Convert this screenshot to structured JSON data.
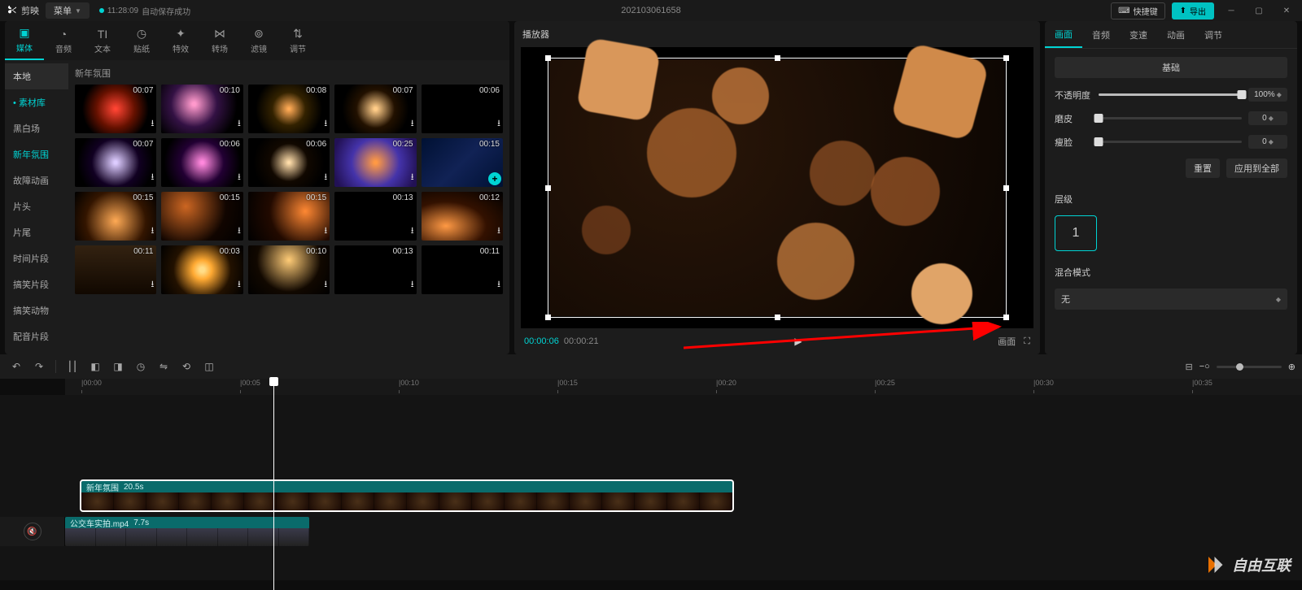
{
  "titleBar": {
    "appName": "剪映",
    "menu": "菜单",
    "autoSaveTime": "11:28:09",
    "autoSaveText": "自动保存成功",
    "projectName": "202103061658",
    "shortcut": "快捷键",
    "export": "导出"
  },
  "mediaTabs": [
    {
      "label": "媒体",
      "icon": "▣"
    },
    {
      "label": "音频",
      "icon": "◔"
    },
    {
      "label": "文本",
      "icon": "TI"
    },
    {
      "label": "贴纸",
      "icon": "◷"
    },
    {
      "label": "特效",
      "icon": "✦"
    },
    {
      "label": "转场",
      "icon": "⋈"
    },
    {
      "label": "滤镜",
      "icon": "⊚"
    },
    {
      "label": "调节",
      "icon": "⇅"
    }
  ],
  "mediaSide": {
    "items": [
      "本地",
      "• 素材库",
      "黑白场",
      "新年氛围",
      "故障动画",
      "片头",
      "片尾",
      "时间片段",
      "搞笑片段",
      "搞笑动物",
      "配音片段"
    ]
  },
  "mediaGrid": {
    "title": "新年氛围",
    "times": [
      "00:07",
      "00:10",
      "00:08",
      "00:07",
      "00:06",
      "00:07",
      "00:06",
      "00:06",
      "00:25",
      "00:15",
      "00:15",
      "00:15",
      "00:15",
      "00:13",
      "00:12",
      "00:11",
      "00:03",
      "00:10",
      "00:13",
      "00:11"
    ]
  },
  "player": {
    "title": "播放器",
    "current": "00:00:06",
    "total": "00:00:21",
    "ratio": "画面"
  },
  "propTabs": [
    "画面",
    "音频",
    "变速",
    "动画",
    "调节"
  ],
  "props": {
    "basic": "基础",
    "opacity": {
      "label": "不透明度",
      "value": "100%",
      "pct": 100
    },
    "skin": {
      "label": "磨皮",
      "value": "0",
      "pct": 0
    },
    "face": {
      "label": "瘦脸",
      "value": "0",
      "pct": 0
    },
    "reset": "重置",
    "applyAll": "应用到全部",
    "layerLabel": "层级",
    "layer": "1",
    "blendLabel": "混合模式",
    "blend": "无"
  },
  "timeline": {
    "ruler": [
      "00:00",
      "00:05",
      "00:10",
      "00:15",
      "00:20",
      "00:25",
      "00:30",
      "00:35"
    ],
    "clip1": {
      "name": "新年氛围",
      "dur": "20.5s"
    },
    "clip2": {
      "name": "公交车实拍.mp4",
      "dur": "7.7s"
    }
  },
  "watermark": "自由互联"
}
